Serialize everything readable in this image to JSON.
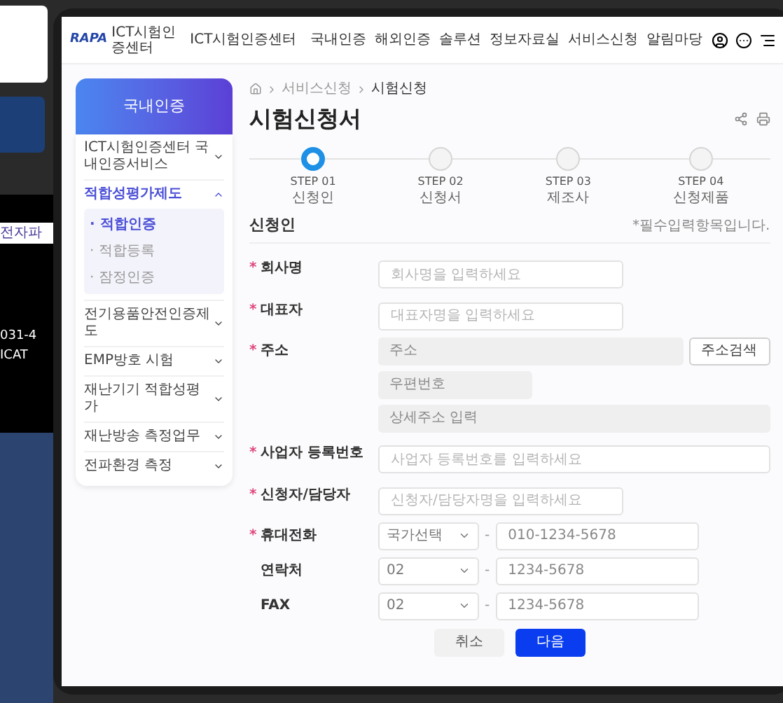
{
  "background": {
    "fragments": [
      "전자파",
      "031-4",
      "ICAT"
    ]
  },
  "header": {
    "logo_mark": "RAPA",
    "logo_text": "ICT시험인증센터",
    "nav": [
      "ICT시험인증센터",
      "국내인증",
      "해외인증",
      "솔루션",
      "정보자료실",
      "서비스신청",
      "알림마당"
    ]
  },
  "sidebar": {
    "banner": "국내인증",
    "items": [
      {
        "label": "ICT시험인증센터 국내인증서비스",
        "expanded": false
      },
      {
        "label": "적합성평가제도",
        "expanded": true,
        "children": [
          {
            "label": "· 적합인증",
            "selected": true
          },
          {
            "label": "· 적합등록",
            "selected": false
          },
          {
            "label": "· 잠정인증",
            "selected": false
          }
        ]
      },
      {
        "label": "전기용품안전인증제도",
        "expanded": false
      },
      {
        "label": "EMP방호 시험",
        "expanded": false
      },
      {
        "label": "재난기기 적합성평가",
        "expanded": false
      },
      {
        "label": "재난방송 측정업무",
        "expanded": false
      },
      {
        "label": "전파환경 측정",
        "expanded": false
      }
    ]
  },
  "breadcrumb": [
    "서비스신청",
    "시험신청"
  ],
  "title": "시험신청서",
  "steps": [
    {
      "step": "STEP 01",
      "label": "신청인",
      "selected": true
    },
    {
      "step": "STEP 02",
      "label": "신청서",
      "selected": false
    },
    {
      "step": "STEP 03",
      "label": "제조사",
      "selected": false
    },
    {
      "step": "STEP 04",
      "label": "신청제품",
      "selected": false
    }
  ],
  "section": {
    "title": "신청인",
    "note": "*필수입력항목입니다."
  },
  "fields": [
    {
      "kind": "short",
      "required_mark": "*",
      "label": "회사명",
      "placeholder": "회사명을 입력하세요"
    },
    {
      "kind": "short",
      "required_mark": "*",
      "label": "대표자",
      "placeholder": "대표자명을 입력하세요"
    },
    {
      "kind": "address",
      "required_mark": "*",
      "label": "주소",
      "inputs": [
        {
          "placeholder": "주소"
        },
        {
          "placeholder": "우편번호"
        },
        {
          "placeholder": "상세주소 입력"
        }
      ],
      "button": "주소검색"
    },
    {
      "kind": "wide",
      "required_mark": "*",
      "label": "사업자 등록번호",
      "placeholder": "사업자 등록번호를 입력하세요"
    },
    {
      "kind": "short",
      "required_mark": "*",
      "label": "신청자/담당자",
      "placeholder": "신청자/담당자명을 입력하세요"
    },
    {
      "kind": "phone",
      "required_mark": "*",
      "label": "휴대전화",
      "select": "국가선택",
      "separator": "-",
      "value": "010-1234-5678"
    },
    {
      "kind": "phone",
      "label": "연락처",
      "select": "02",
      "separator": "-",
      "value": "1234-5678"
    },
    {
      "kind": "phone",
      "label": "FAX",
      "select": "02",
      "separator": "-",
      "value": "1234-5678"
    }
  ],
  "buttons": [
    {
      "kind": "secondary",
      "label": "취소"
    },
    {
      "kind": "primary",
      "label": "다음"
    }
  ]
}
